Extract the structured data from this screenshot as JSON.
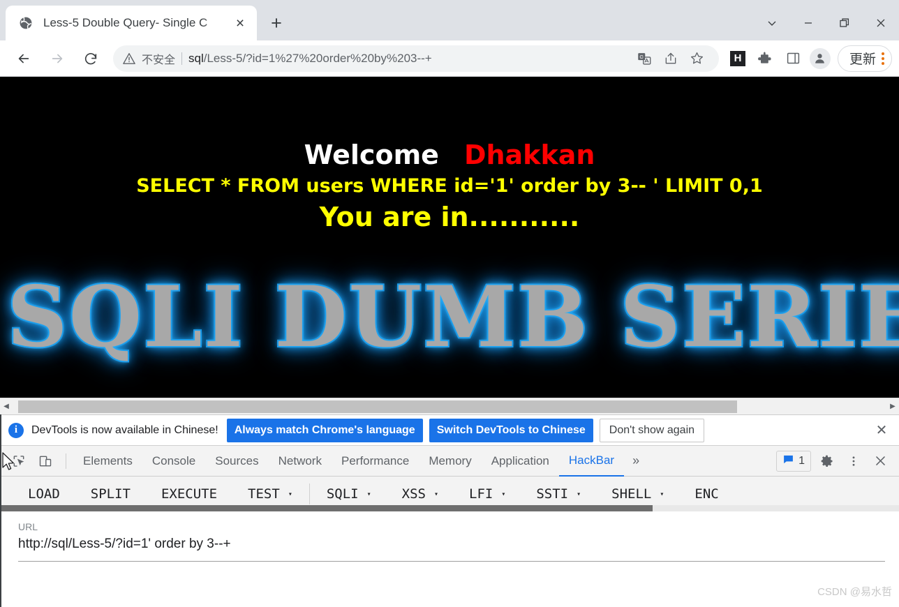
{
  "browser": {
    "tab": {
      "title": "Less-5 Double Query- Single C",
      "favicon_name": "globe-icon",
      "close_label": "×"
    },
    "new_tab_label": "+",
    "window_controls": {
      "chevron": "∨",
      "minimize": "−",
      "maximize": "❐",
      "close": "✕"
    },
    "nav": {
      "back": "←",
      "forward": "→",
      "reload": "⟳"
    },
    "omnibox": {
      "security_label": "不安全",
      "url_prefix": "sql",
      "url_rest": "/Less-5/?id=1%27%20order%20by%203--+",
      "translate_icon": "translate-icon",
      "share_icon": "share-icon",
      "bookmark_icon": "star-icon"
    },
    "extensions": {
      "hackbar_letter": "H",
      "puzzle_icon": "extensions-puzzle-icon",
      "sidepanel_icon": "side-panel-icon",
      "profile_icon": "profile-avatar-icon"
    },
    "update_button": {
      "label": "更新",
      "accent_color": "#e8710a"
    }
  },
  "page": {
    "welcome_text": "Welcome",
    "user_name": "Dhakkan",
    "sql_query": "SELECT * FROM users WHERE id='1' order by 3-- ' LIMIT 0,1",
    "status_text": "You are in...........",
    "banner_text": "SQLI DUMB SERIES",
    "colors": {
      "background": "#000000",
      "welcome": "#ffffff",
      "user_name": "#ff0000",
      "query": "#ffff00",
      "banner_glow": "#1ba1f2",
      "banner_fill": "#a8a8a8"
    },
    "scrollbar": {
      "left_arrow": "◀",
      "right_arrow": "▶"
    }
  },
  "devtools": {
    "notification": {
      "message": "DevTools is now available in Chinese!",
      "info_icon": "info-icon",
      "primary_button": "Always match Chrome's language",
      "secondary_button": "Switch DevTools to Chinese",
      "dismiss_button": "Don't show again",
      "close_label": "✕"
    },
    "toolbar_icons": {
      "inspect": "inspect-element-icon",
      "device": "device-toolbar-icon"
    },
    "tabs": [
      {
        "label": "Elements",
        "active": false
      },
      {
        "label": "Console",
        "active": false
      },
      {
        "label": "Sources",
        "active": false
      },
      {
        "label": "Network",
        "active": false
      },
      {
        "label": "Performance",
        "active": false
      },
      {
        "label": "Memory",
        "active": false
      },
      {
        "label": "Application",
        "active": false
      },
      {
        "label": "HackBar",
        "active": true
      }
    ],
    "more_tabs_label": "»",
    "messages_badge": {
      "icon": "message-icon",
      "count": "1"
    },
    "settings_icon": "gear-icon",
    "kebab_icon": "more-vertical-icon",
    "close_label": "✕"
  },
  "hackbar": {
    "buttons": [
      {
        "label": "LOAD",
        "caret": false
      },
      {
        "label": "SPLIT",
        "caret": false
      },
      {
        "label": "EXECUTE",
        "caret": false
      },
      {
        "label": "TEST",
        "caret": true
      },
      {
        "label": "SQLI",
        "caret": true
      },
      {
        "label": "XSS",
        "caret": true
      },
      {
        "label": "LFI",
        "caret": true
      },
      {
        "label": "SSTI",
        "caret": true
      },
      {
        "label": "SHELL",
        "caret": true
      },
      {
        "label": "ENC",
        "caret": false
      }
    ],
    "caret_glyph": "▾",
    "url_field": {
      "label": "URL",
      "value": "http://sql/Less-5/?id=1' order by 3--+"
    }
  },
  "watermark": "CSDN @易水哲"
}
